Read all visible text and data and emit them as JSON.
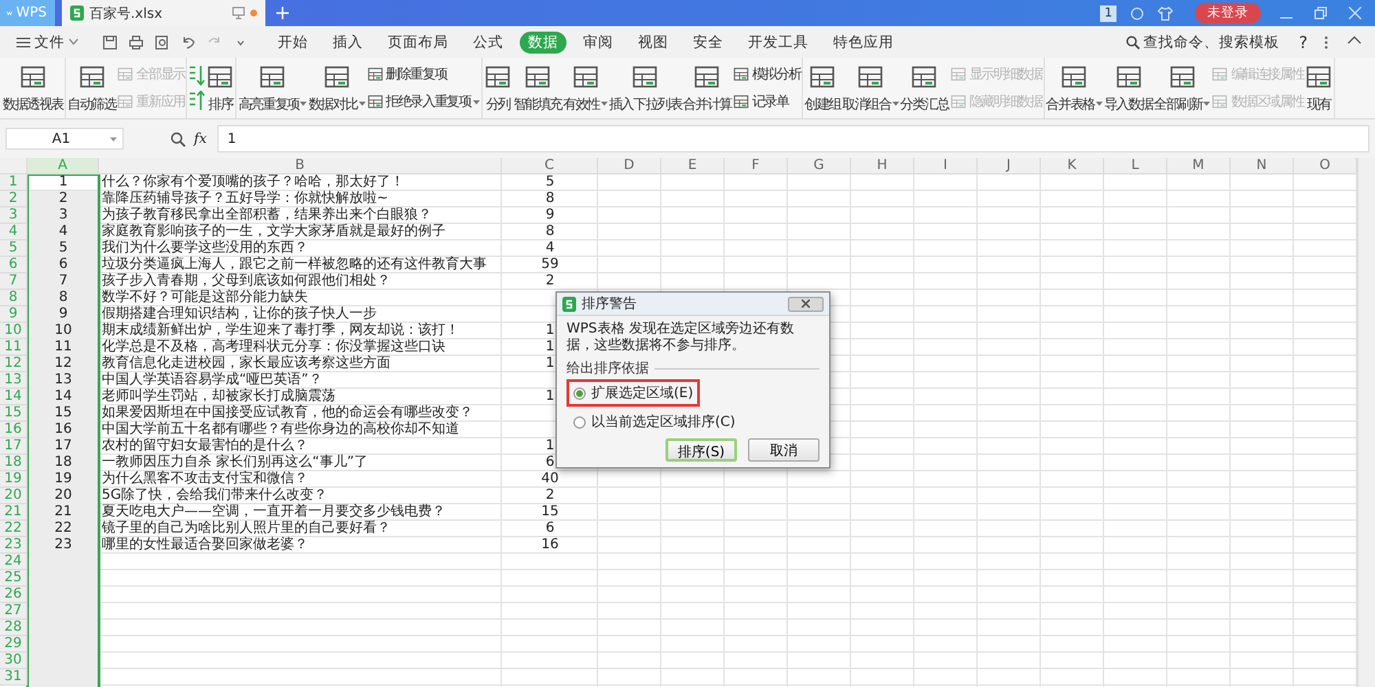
{
  "titlebar": {
    "app_tab": "WPS",
    "file_tab": "百家号.xlsx",
    "badge": "1",
    "account": "未登录"
  },
  "menu": {
    "file": "文件",
    "tabs": [
      {
        "label": "开始",
        "selected": false
      },
      {
        "label": "插入",
        "selected": false
      },
      {
        "label": "页面布局",
        "selected": false
      },
      {
        "label": "公式",
        "selected": false
      },
      {
        "label": "数据",
        "selected": true
      },
      {
        "label": "审阅",
        "selected": false
      },
      {
        "label": "视图",
        "selected": false
      },
      {
        "label": "安全",
        "selected": false
      },
      {
        "label": "开发工具",
        "selected": false
      },
      {
        "label": "特色应用",
        "selected": false
      }
    ],
    "search": "查找命令、搜索模板",
    "help": "?"
  },
  "ribbon": {
    "groups": [
      {
        "items": [
          {
            "kind": "big",
            "label": "数据透视表",
            "disabled": false,
            "dropdown": false
          }
        ]
      },
      {
        "items": [
          {
            "kind": "big",
            "label": "自动筛选",
            "disabled": false,
            "dropdown": false
          },
          {
            "kind": "small",
            "label": "全部显示",
            "disabled": true,
            "dropdown": false
          },
          {
            "kind": "small",
            "label": "重新应用",
            "disabled": true,
            "dropdown": false
          }
        ]
      },
      {
        "items": [
          {
            "kind": "sort-pair",
            "disabled": false
          },
          {
            "kind": "big",
            "label": "排序",
            "disabled": false,
            "dropdown": false
          }
        ]
      },
      {
        "items": [
          {
            "kind": "big",
            "label": "高亮重复项",
            "disabled": false,
            "dropdown": true
          },
          {
            "kind": "big",
            "label": "数据对比",
            "disabled": false,
            "dropdown": true
          },
          {
            "kind": "small",
            "label": "删除重复项",
            "disabled": false,
            "dropdown": false
          },
          {
            "kind": "small",
            "label": "拒绝录入重复项",
            "disabled": false,
            "dropdown": true
          }
        ]
      },
      {
        "items": [
          {
            "kind": "big",
            "label": "分列",
            "disabled": false,
            "dropdown": false
          },
          {
            "kind": "big",
            "label": "智能填充",
            "disabled": false,
            "dropdown": false
          },
          {
            "kind": "big",
            "label": "有效性",
            "disabled": false,
            "dropdown": true
          },
          {
            "kind": "big",
            "label": "插入下拉列表",
            "disabled": false,
            "dropdown": false
          },
          {
            "kind": "big",
            "label": "合并计算",
            "disabled": false,
            "dropdown": false
          },
          {
            "kind": "small",
            "label": "模拟分析",
            "disabled": false,
            "dropdown": false
          },
          {
            "kind": "small",
            "label": "记录单",
            "disabled": false,
            "dropdown": false
          }
        ]
      },
      {
        "items": [
          {
            "kind": "big",
            "label": "创建组",
            "disabled": false,
            "dropdown": false
          },
          {
            "kind": "big",
            "label": "取消组合",
            "disabled": false,
            "dropdown": true
          },
          {
            "kind": "big",
            "label": "分类汇总",
            "disabled": false,
            "dropdown": false
          },
          {
            "kind": "small",
            "label": "显示明细数据",
            "disabled": true,
            "dropdown": false
          },
          {
            "kind": "small",
            "label": "隐藏明细数据",
            "disabled": true,
            "dropdown": false
          }
        ]
      },
      {
        "items": [
          {
            "kind": "big",
            "label": "合并表格",
            "disabled": false,
            "dropdown": true
          },
          {
            "kind": "big",
            "label": "导入数据",
            "disabled": false,
            "dropdown": false
          },
          {
            "kind": "big",
            "label": "全部刷新",
            "disabled": false,
            "dropdown": true
          },
          {
            "kind": "small",
            "label": "编辑连接属性",
            "disabled": true,
            "dropdown": false
          },
          {
            "kind": "small",
            "label": "数据区域属性",
            "disabled": true,
            "dropdown": false
          },
          {
            "kind": "big",
            "label": "现有",
            "disabled": false,
            "dropdown": false
          }
        ]
      }
    ]
  },
  "formula_bar": {
    "name_box": "A1",
    "fx": "fx",
    "formula": "1"
  },
  "sheet": {
    "columns": [
      {
        "label": "A",
        "selected": true
      },
      {
        "label": "B",
        "selected": false
      },
      {
        "label": "C",
        "selected": false
      },
      {
        "label": "D",
        "selected": false
      },
      {
        "label": "E",
        "selected": false
      },
      {
        "label": "F",
        "selected": false
      },
      {
        "label": "G",
        "selected": false
      },
      {
        "label": "H",
        "selected": false
      },
      {
        "label": "I",
        "selected": false
      },
      {
        "label": "J",
        "selected": false
      },
      {
        "label": "K",
        "selected": false
      },
      {
        "label": "L",
        "selected": false
      },
      {
        "label": "M",
        "selected": false
      },
      {
        "label": "N",
        "selected": false
      },
      {
        "label": "O",
        "selected": false
      }
    ],
    "rows": [
      {
        "number": "1",
        "a": "1",
        "b": "什么？你家有个爱顶嘴的孩子？哈哈，那太好了！",
        "c": "5"
      },
      {
        "number": "2",
        "a": "2",
        "b": "靠降压药辅导孩子？五好导学：你就快解放啦~",
        "c": "8"
      },
      {
        "number": "3",
        "a": "3",
        "b": "为孩子教育移民拿出全部积蓄，结果养出来个白眼狼？",
        "c": "9"
      },
      {
        "number": "4",
        "a": "4",
        "b": "家庭教育影响孩子的一生，文学大家茅盾就是最好的例子",
        "c": "8"
      },
      {
        "number": "5",
        "a": "5",
        "b": "我们为什么要学这些没用的东西？",
        "c": "4"
      },
      {
        "number": "6",
        "a": "6",
        "b": "垃圾分类逼疯上海人，跟它之前一样被忽略的还有这件教育大事",
        "c": "59"
      },
      {
        "number": "7",
        "a": "7",
        "b": "孩子步入青春期，父母到底该如何跟他们相处？",
        "c": "2"
      },
      {
        "number": "8",
        "a": "8",
        "b": "数学不好？可能是这部分能力缺失"
      },
      {
        "number": "9",
        "a": "9",
        "b": "假期搭建合理知识结构，让你的孩子快人一步"
      },
      {
        "number": "10",
        "a": "10",
        "b": "期末成绩新鲜出炉，学生迎来了毒打季，网友却说：该打！",
        "c": "1"
      },
      {
        "number": "11",
        "a": "11",
        "b": "化学总是不及格，高考理科状元分享：你没掌握这些口诀",
        "c": "1"
      },
      {
        "number": "12",
        "a": "12",
        "b": "教育信息化走进校园，家长最应该考察这些方面",
        "c": "1"
      },
      {
        "number": "13",
        "a": "13",
        "b": "中国人学英语容易学成“哑巴英语”？"
      },
      {
        "number": "14",
        "a": "14",
        "b": "老师叫学生罚站，却被家长打成脑震荡",
        "c": "1"
      },
      {
        "number": "15",
        "a": "15",
        "b": "如果爱因斯坦在中国接受应试教育，他的命运会有哪些改变？"
      },
      {
        "number": "16",
        "a": "16",
        "b": "中国大学前五十名都有哪些？有些你身边的高校你却不知道"
      },
      {
        "number": "17",
        "a": "17",
        "b": "农村的留守妇女最害怕的是什么？",
        "c": "1"
      },
      {
        "number": "18",
        "a": "18",
        "b": "一教师因压力自杀 家长们别再这么“事儿”了",
        "c": "6"
      },
      {
        "number": "19",
        "a": "19",
        "b": "为什么黑客不攻击支付宝和微信？",
        "c": "40"
      },
      {
        "number": "20",
        "a": "20",
        "b": "5G除了快，会给我们带来什么改变？",
        "c": "2"
      },
      {
        "number": "21",
        "a": "21",
        "b": "夏天吃电大户——空调，一直开着一月要交多少钱电费？",
        "c": "15"
      },
      {
        "number": "22",
        "a": "22",
        "b": "镜子里的自己为啥比别人照片里的自己要好看？",
        "c": "6"
      },
      {
        "number": "23",
        "a": "23",
        "b": "哪里的女性最适合娶回家做老婆？",
        "c": "16"
      },
      {
        "number": "24"
      },
      {
        "number": "25"
      },
      {
        "number": "26"
      },
      {
        "number": "27"
      },
      {
        "number": "28"
      },
      {
        "number": "29"
      },
      {
        "number": "30"
      },
      {
        "number": "31"
      }
    ]
  },
  "dialog": {
    "title": "排序警告",
    "message": "WPS表格 发现在选定区域旁边还有数据，这些数据将不参与排序。",
    "group_label": "给出排序依据",
    "options": [
      {
        "label": "扩展选定区域(E)",
        "selected": true,
        "highlighted": true
      },
      {
        "label": "以当前选定区域排序(C)",
        "selected": false,
        "highlighted": false
      }
    ],
    "buttons": [
      {
        "label": "排序(S)",
        "default": true
      },
      {
        "label": "取消",
        "default": false
      }
    ]
  }
}
